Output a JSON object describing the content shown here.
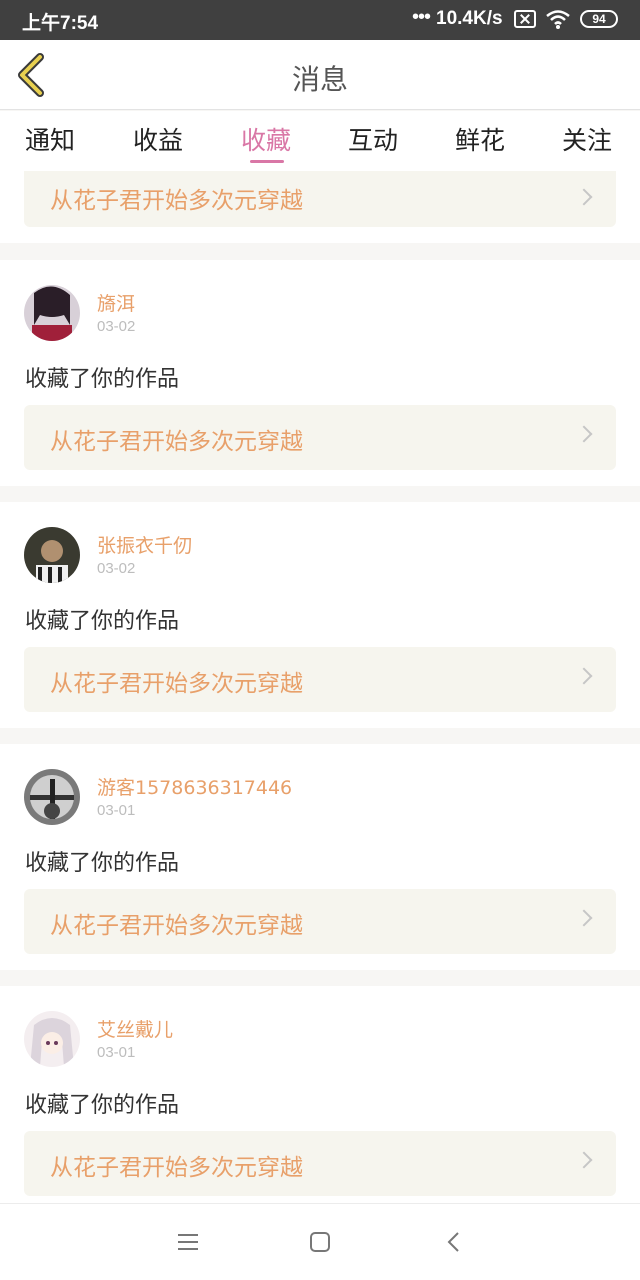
{
  "status_bar": {
    "time": "上午7:54",
    "dots": "•••",
    "net_speed": "10.4K/s",
    "battery": "94"
  },
  "header": {
    "title": "消息"
  },
  "tabs": [
    {
      "label": "通知"
    },
    {
      "label": "收益"
    },
    {
      "label": "收藏",
      "active": true
    },
    {
      "label": "互动"
    },
    {
      "label": "鲜花"
    },
    {
      "label": "关注"
    }
  ],
  "partial_top": {
    "work_title": "从花子君开始多次元穿越"
  },
  "items": [
    {
      "user": "旖洱",
      "date": "03-02",
      "action": "收藏了你的作品",
      "work_title": "从花子君开始多次元穿越"
    },
    {
      "user": "张振衣千仞",
      "date": "03-02",
      "action": "收藏了你的作品",
      "work_title": "从花子君开始多次元穿越"
    },
    {
      "user": "游客1578636317446",
      "date": "03-01",
      "action": "收藏了你的作品",
      "work_title": "从花子君开始多次元穿越"
    },
    {
      "user": "艾丝戴儿",
      "date": "03-01",
      "action": "收藏了你的作品",
      "work_title": "从花子君开始多次元穿越"
    }
  ],
  "colors": {
    "accent": "#d977a6",
    "orange": "#e8a06a",
    "back_icon": "#e0c040"
  },
  "icons": [
    "back-icon",
    "wifi-icon",
    "close-box-icon",
    "menu-icon",
    "home-icon",
    "back-nav-icon",
    "chevron-right-icon"
  ]
}
